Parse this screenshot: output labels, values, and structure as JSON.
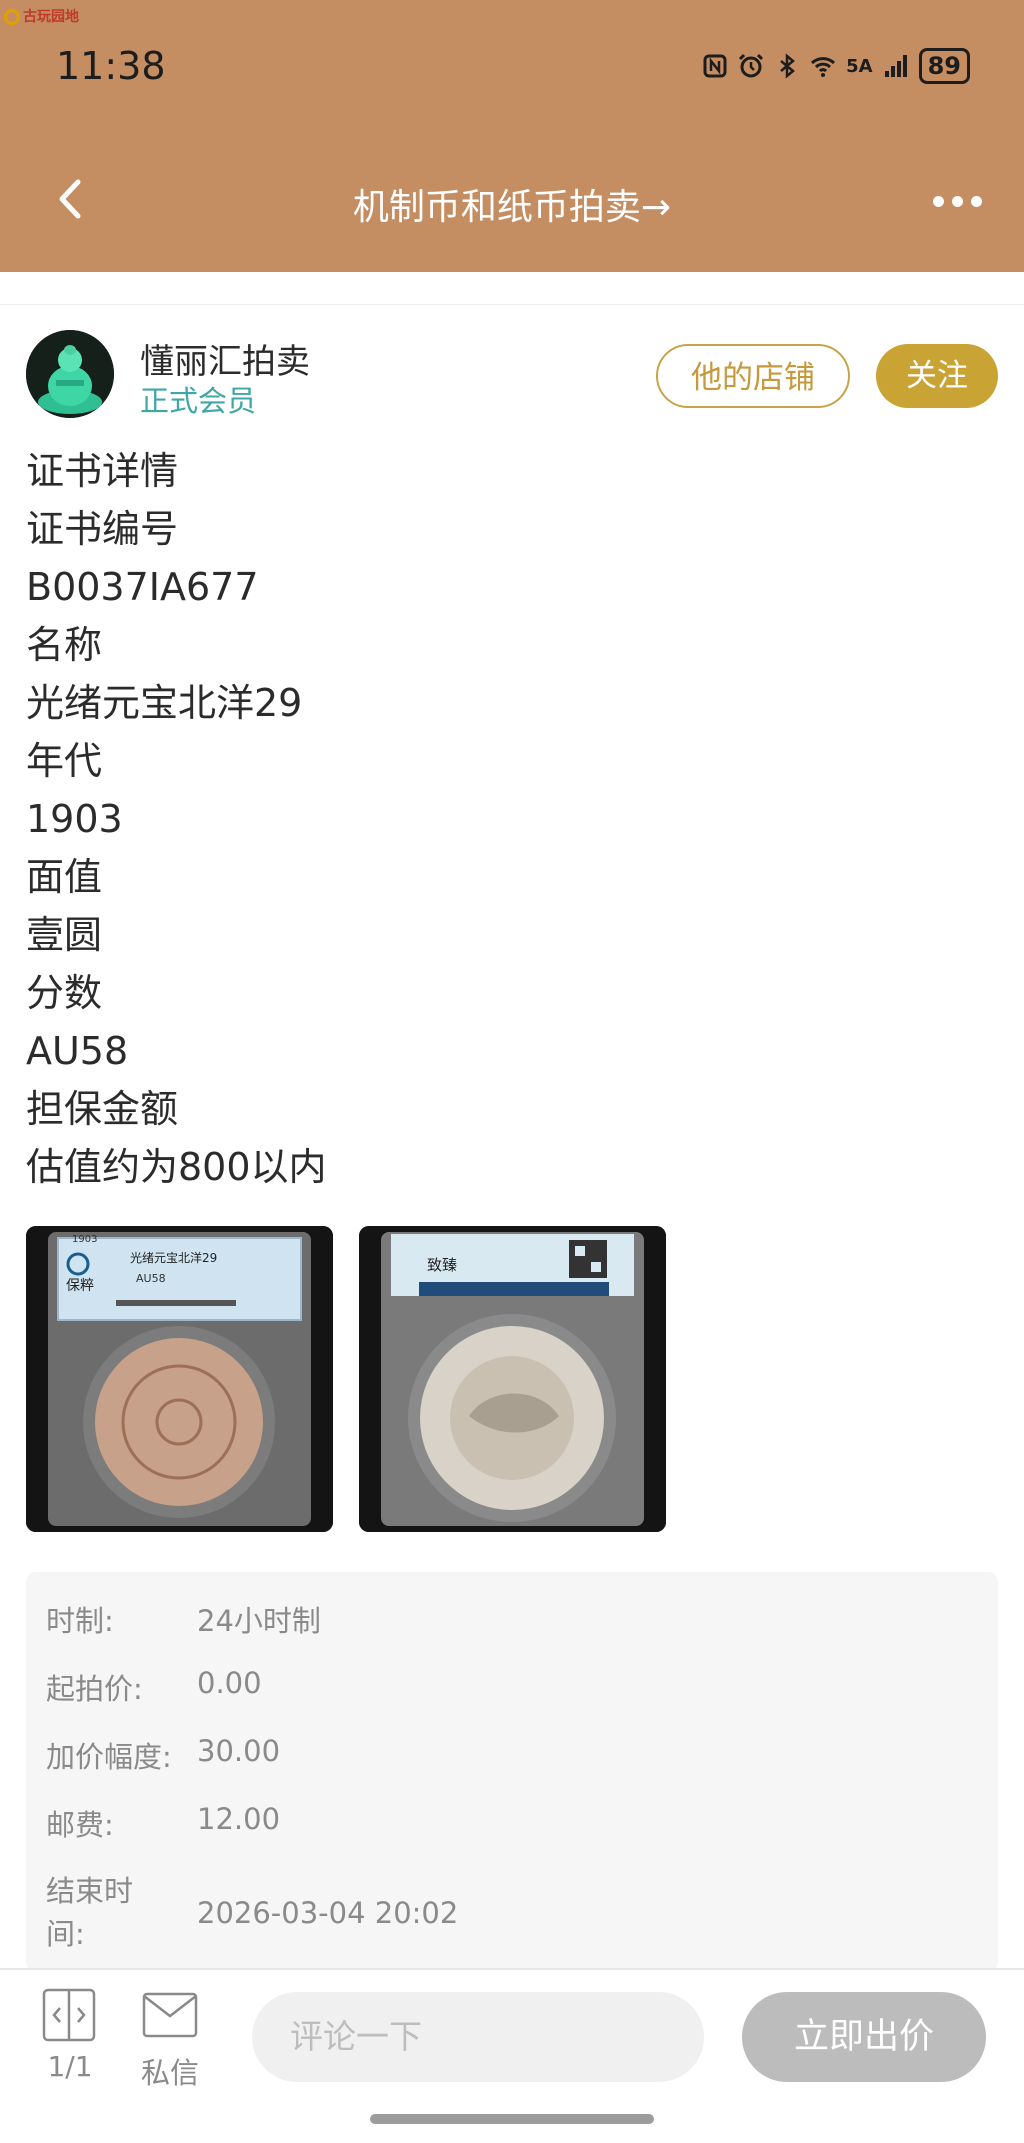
{
  "watermark": "古玩园地",
  "status_bar": {
    "time": "11:38",
    "battery": "89",
    "network": "5A"
  },
  "nav": {
    "title": "机制币和纸币拍卖→"
  },
  "seller": {
    "name": "懂丽汇拍卖",
    "role": "正式会员",
    "shop_label": "他的店铺",
    "follow_label": "关注"
  },
  "description": [
    "证书详情",
    "证书编号",
    "B0037IA677",
    "名称",
    "光绪元宝北洋29",
    "年代",
    "1903",
    "面值",
    "壹圆",
    "分数",
    "AU58",
    "担保金额",
    "估值约为800以内"
  ],
  "photos": [
    {
      "label_year": "1903",
      "label_title": "光绪元宝北洋29",
      "label_grade": "AU58",
      "label_brand": "保粹"
    },
    {
      "label_brand": "致臻"
    }
  ],
  "auction_info": [
    {
      "key": "时制:",
      "value": "24小时制"
    },
    {
      "key": "起拍价:",
      "value": "0.00"
    },
    {
      "key": "加价幅度:",
      "value": "30.00"
    },
    {
      "key": "邮费:",
      "value": "12.00"
    },
    {
      "key_line1": "结束时",
      "key_line2": "间:",
      "value": "2026-03-04 20:02"
    }
  ],
  "bottom_bar": {
    "page_label": "1/1",
    "message_label": "私信",
    "comment_placeholder": "评论一下",
    "bid_label": "立即出价"
  },
  "colors": {
    "header": "#c48d62",
    "gold": "#c9a334",
    "teal": "#3fa7a5",
    "bid_disabled": "#bcbcbc"
  }
}
